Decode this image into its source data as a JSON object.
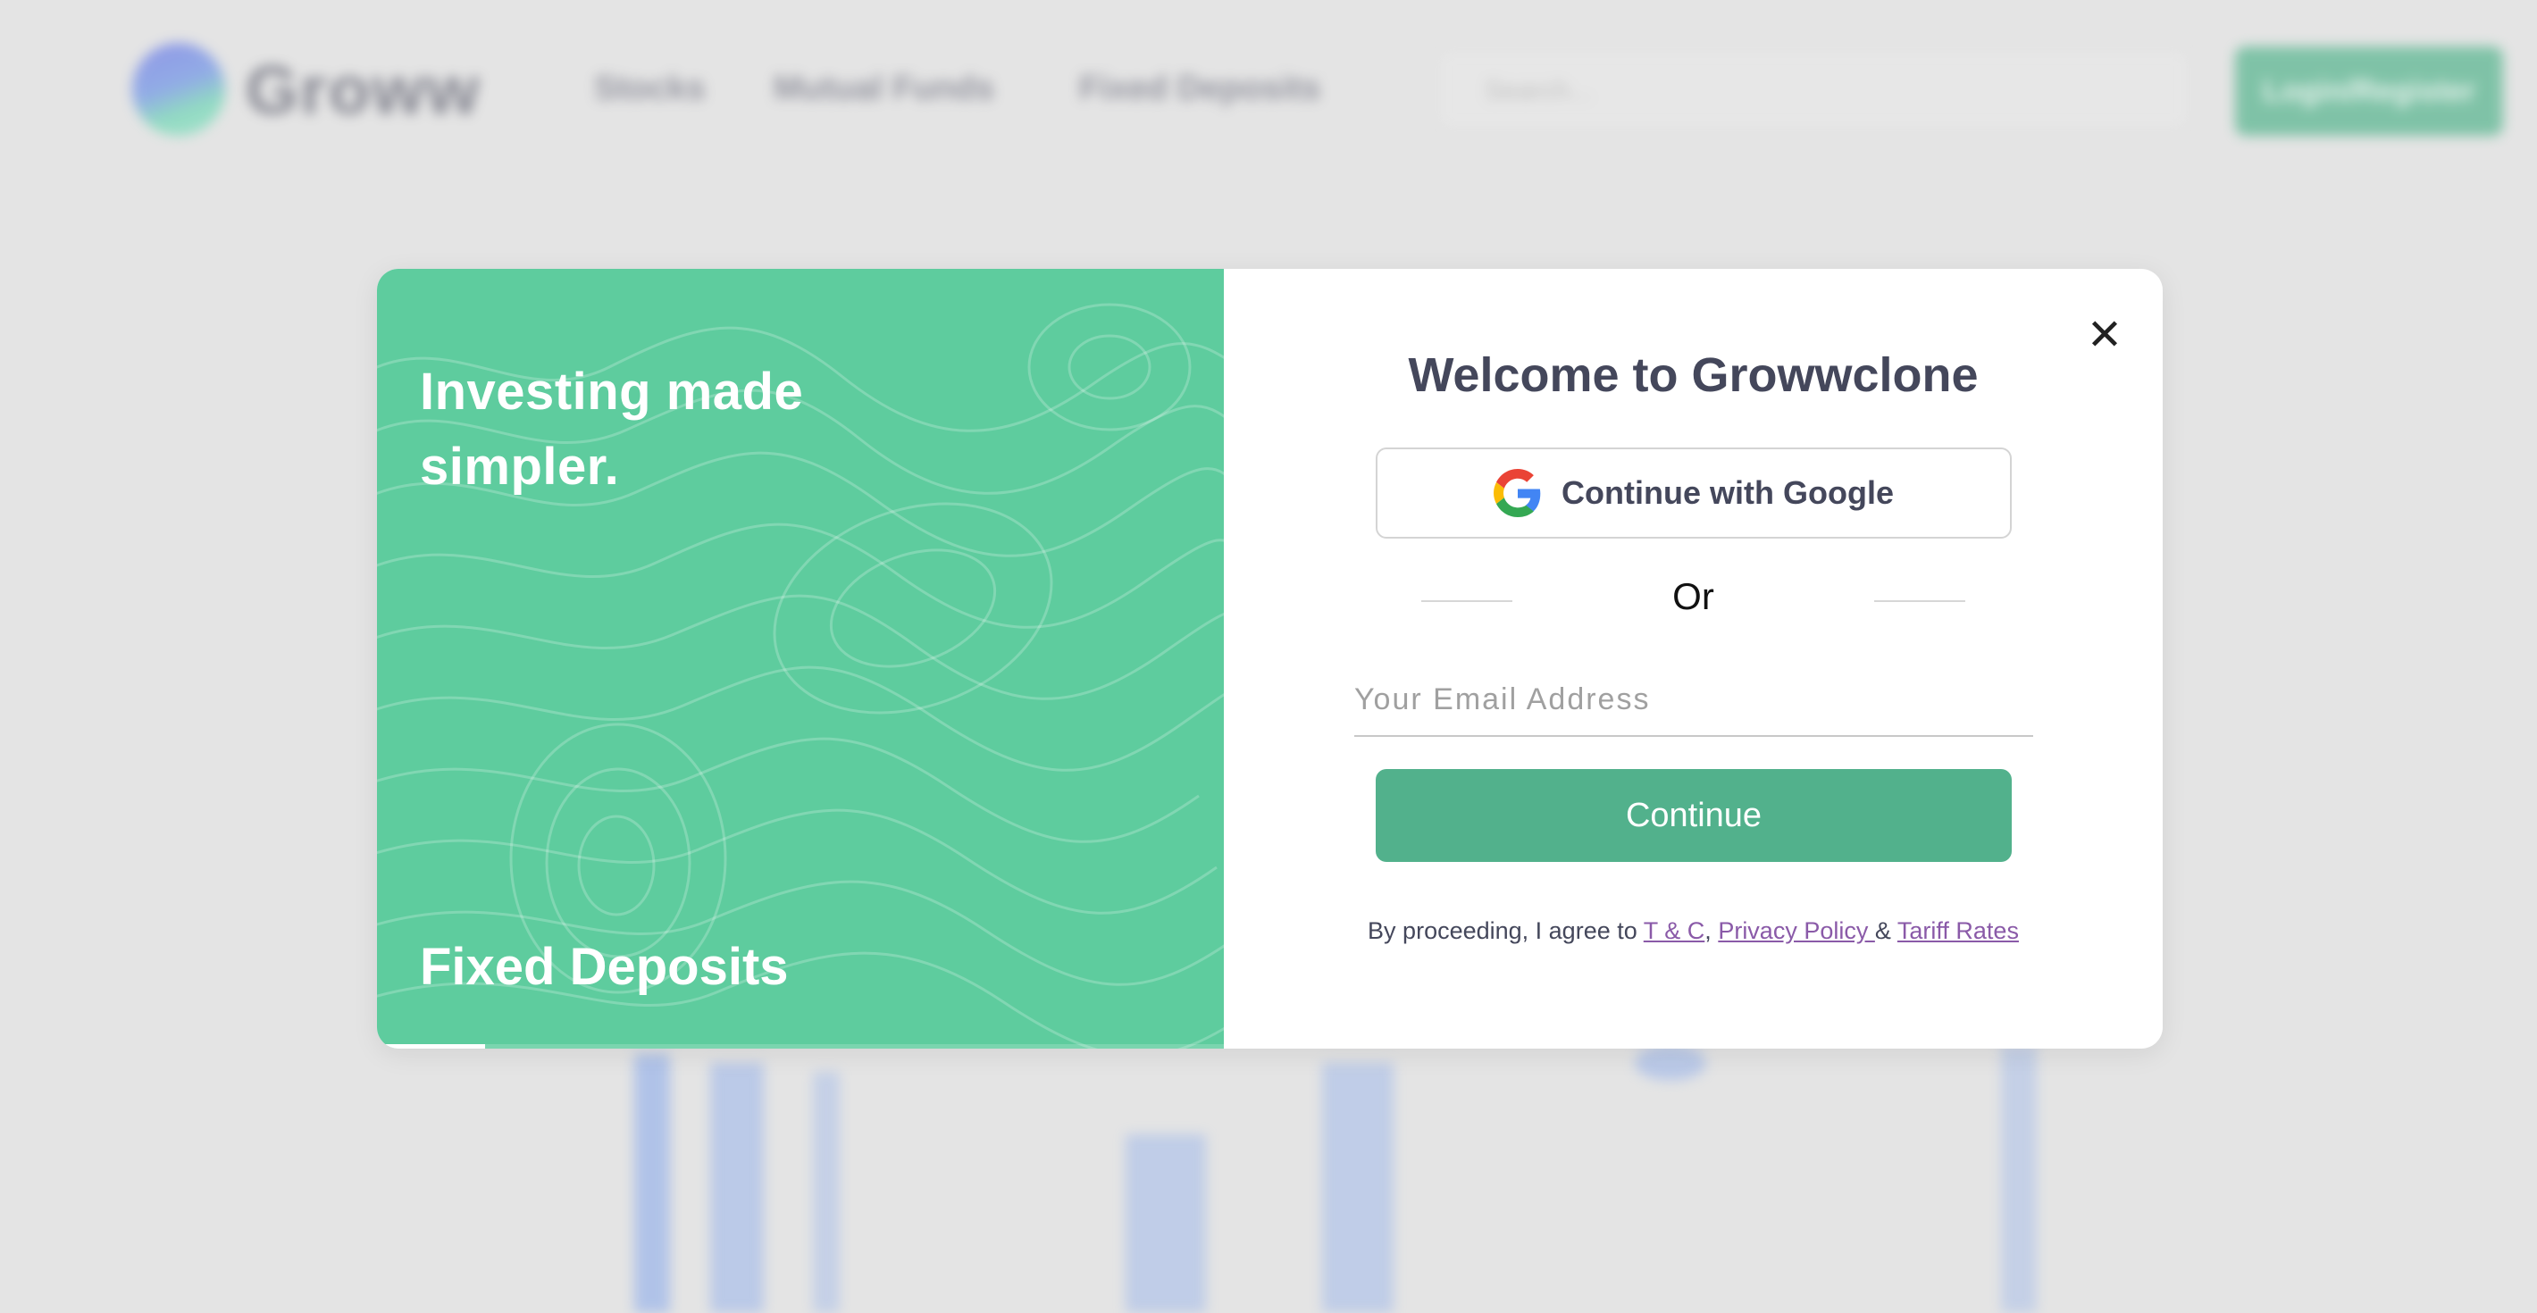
{
  "background": {
    "brand_name": "Groww",
    "nav": [
      "Stocks",
      "Mutual Funds",
      "Fixed Deposits"
    ],
    "search_placeholder": "Search...",
    "login_label": "Login/Register"
  },
  "modal": {
    "left_panel": {
      "tagline": "Investing made simpler.",
      "slide_caption": "Fixed Deposits",
      "slide_progress_fraction": 0.12,
      "bg_color": "#5ecc9e"
    },
    "right_panel": {
      "close_icon": "close-icon",
      "title": "Welcome to Growwclone",
      "google_button": {
        "icon": "google-icon",
        "label": "Continue with Google"
      },
      "divider_text": "Or",
      "email": {
        "placeholder": "Your Email Address",
        "value": ""
      },
      "continue_label": "Continue",
      "legal": {
        "prefix": "By proceeding, I agree to ",
        "tc": "T & C",
        "comma": ",",
        "privacy": "Privacy Policy ",
        "amp": " & ",
        "tariff": "Tariff Rates"
      }
    }
  },
  "colors": {
    "accent": "#52b18c",
    "panel_green": "#5ecc9e",
    "title_text": "#44475b",
    "link": "#8a5aa8"
  }
}
